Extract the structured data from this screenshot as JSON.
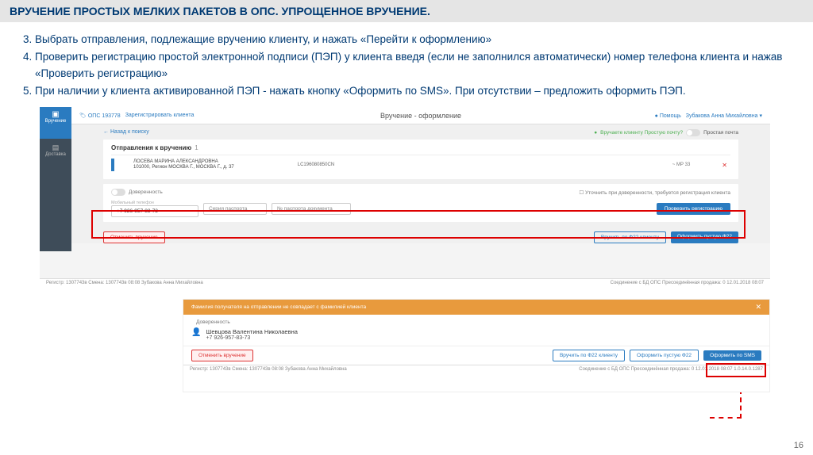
{
  "header": "ВРУЧЕНИЕ ПРОСТЫХ МЕЛКИХ ПАКЕТОВ В ОПС. УПРОЩЕННОЕ ВРУЧЕНИЕ.",
  "instructions": {
    "start": 3,
    "items": [
      "Выбрать отправления, подлежащие вручению клиенту, и нажать «Перейти к оформлению»",
      "Проверить регистрацию простой электронной подписи (ПЭП) у клиента введя (если не заполнился автоматически) номер телефона клиента и нажав «Проверить регистрацию»",
      "При наличии у клиента активированной ПЭП - нажать кнопку «Оформить по SMS». При отсутствии – предложить оформить ПЭП."
    ]
  },
  "s1": {
    "sidebar": {
      "item1": "Вручение",
      "item2": "Доставка"
    },
    "top": {
      "ops": "ОПС 193778",
      "register_client": "Зарегистрировать клиента",
      "title": "Вручение - оформление",
      "help": "Помощь",
      "user": "Зубакова Анна Михайловна"
    },
    "back": "← Назад к поиску",
    "deliverQuestion": "Вручаете клиенту Простую почту?",
    "simpleMail": "Простая почта",
    "panelTitle": "Отправления к вручению",
    "panelCount": "1",
    "row": {
      "name1": "ЛОСЕВА МАРИНА АЛЕКСАНДРОВНА",
      "name2": "101000, Регион МОСКВА Г., МОСКВА Г., д. 37",
      "code": "LC196080850CN",
      "tag": "~ МР 33"
    },
    "switch": {
      "proxy": "Доверенность",
      "checkbox": "Уточнить при доверенности, требуется регистрация клиента"
    },
    "inputs": {
      "phone_label": "Мобильный телефон",
      "phone": "+7 926-957-83-73",
      "series_label": "Серия паспорта",
      "number_label": "№ паспорта документа"
    },
    "checkBtn": "Проверить регистрацию",
    "cancelBtn": "Отменить вручение",
    "f22Btn": "Вручить по Ф22 клиенту",
    "emptyF22Btn": "Оформить пустую Ф22",
    "status": {
      "left": "Регистр: 1307743в   Смена: 1307743в 08:08   Зубакова Анна Михайловна",
      "right": "Соединение с БД ОПС   Пресоединённая продажа: 0   12.01.2018 08:07"
    }
  },
  "s2": {
    "warn": "Фамилия получателя на отправлении не совпадает с фамилией клиента",
    "proxy": "Доверенность",
    "name": "Шевцова Валентина Николаевна",
    "phone": "+7 926-957-83-73",
    "cancelBtn": "Отменить вручение",
    "f22Btn": "Вручить по Ф22 клиенту",
    "emptyF22Btn": "Оформить пустую Ф22",
    "smsBtn": "Оформить по SMS",
    "status": {
      "left": "Регистр: 1307743в   Смена: 1307743в 08:08   Зубакова Анна Михайловна",
      "right": "Соединение с БД ОПС   Пресоединённая продажа: 0   12.01.2018 08:07   1.0.14.0.1287"
    }
  },
  "pageNum": "16"
}
